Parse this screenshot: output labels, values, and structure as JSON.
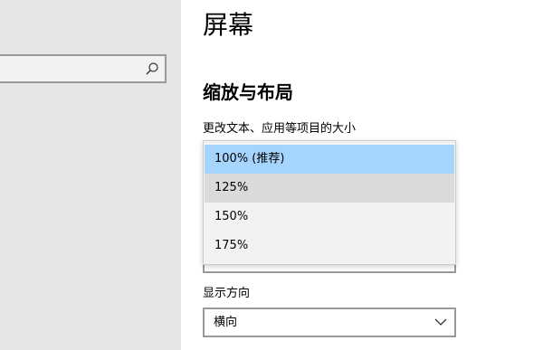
{
  "sidebar": {
    "search": {
      "value": "",
      "icon": "search-icon"
    }
  },
  "main": {
    "title": "屏幕",
    "section_title": "缩放与布局",
    "scale": {
      "label": "更改文本、应用等项目的大小",
      "options": [
        "100% (推荐)",
        "125%",
        "150%",
        "175%"
      ],
      "selected": "100% (推荐)",
      "hovered": "125%"
    },
    "orientation": {
      "label": "显示方向",
      "value": "横向",
      "icon": "chevron-down-icon"
    }
  },
  "colors": {
    "sidebar_bg": "#e6e6e6",
    "selected_bg": "#a5d5fd",
    "hover_bg": "#dadada",
    "popup_bg": "#f2f2f2",
    "border": "#999999"
  }
}
